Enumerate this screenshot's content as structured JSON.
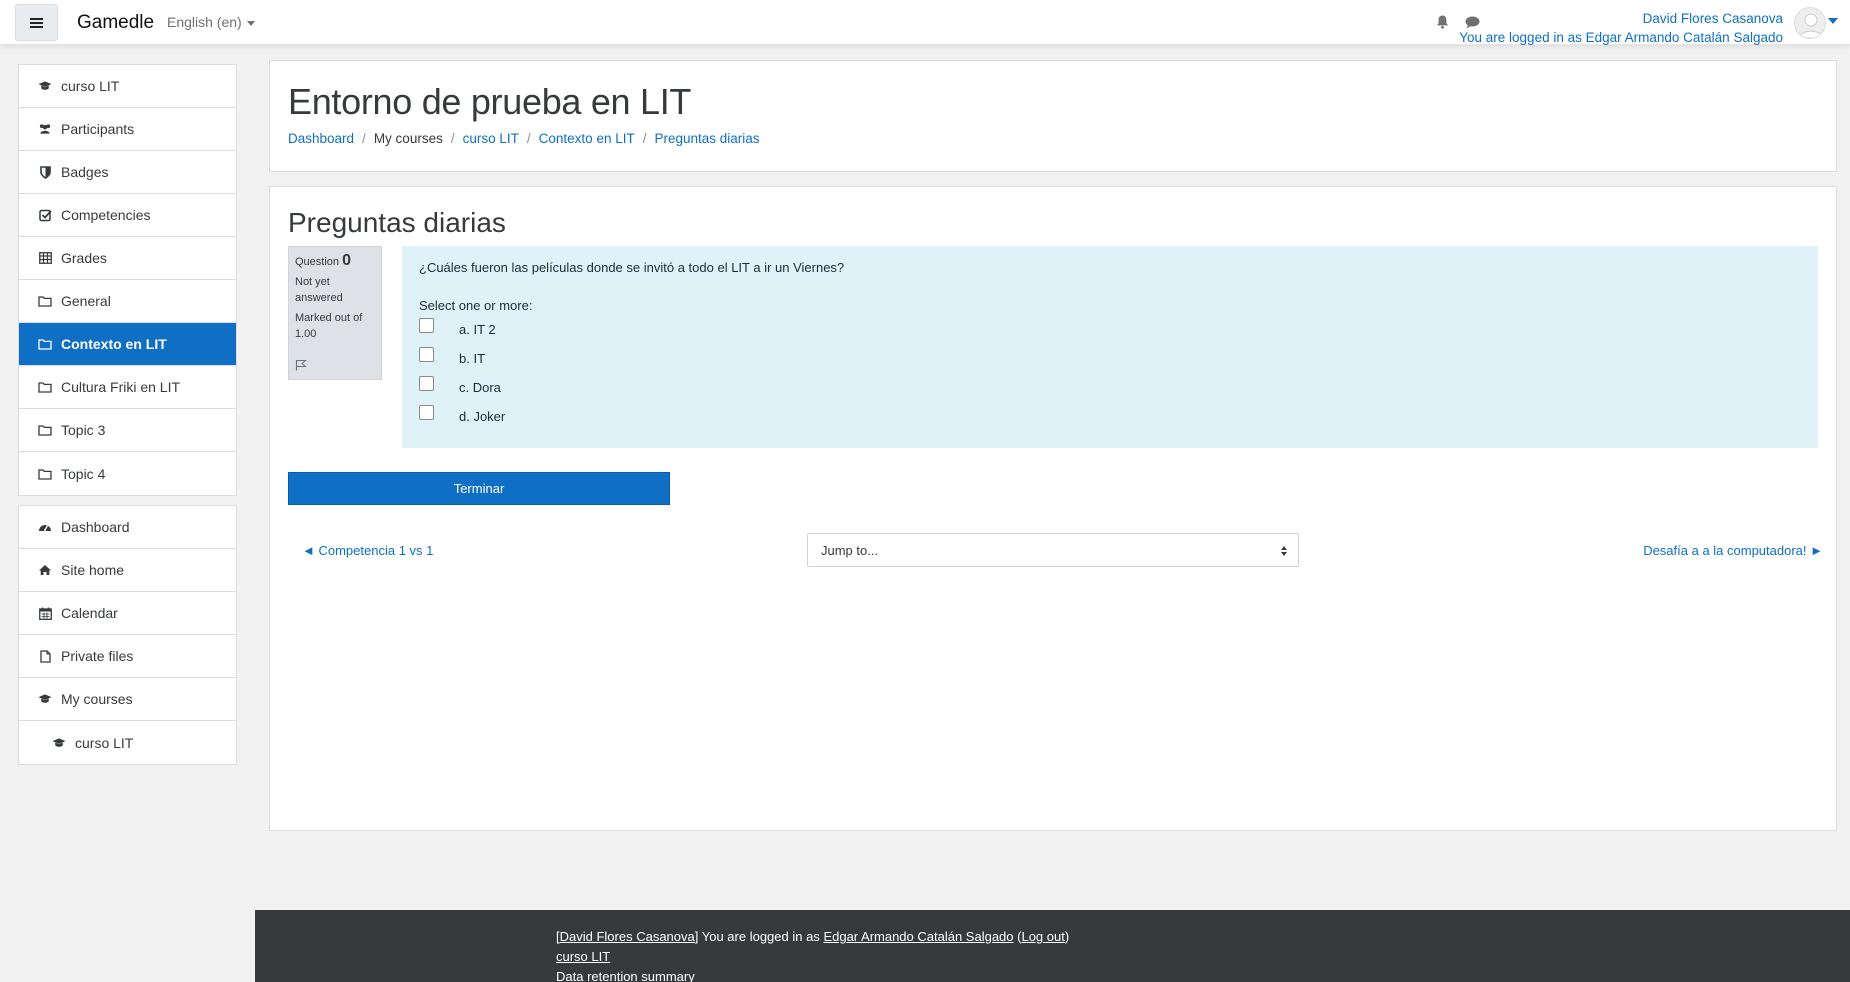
{
  "navbar": {
    "brand": "Gamedle",
    "language": "English (en)",
    "user_name": "David Flores Casanova",
    "logged_in_as": "You are logged in as Edgar Armando Catalán Salgado"
  },
  "sidebar": {
    "course_items": [
      {
        "label": "curso LIT",
        "icon": "graduation-cap-icon"
      },
      {
        "label": "Participants",
        "icon": "users-icon"
      },
      {
        "label": "Badges",
        "icon": "shield-icon"
      },
      {
        "label": "Competencies",
        "icon": "checkbox-icon"
      },
      {
        "label": "Grades",
        "icon": "table-icon"
      },
      {
        "label": "General",
        "icon": "folder-icon"
      },
      {
        "label": "Contexto en LIT",
        "icon": "folder-icon",
        "active": true
      },
      {
        "label": "Cultura Friki en LIT",
        "icon": "folder-icon"
      },
      {
        "label": "Topic 3",
        "icon": "folder-icon"
      },
      {
        "label": "Topic 4",
        "icon": "folder-icon"
      }
    ],
    "site_items": [
      {
        "label": "Dashboard",
        "icon": "dashboard-icon"
      },
      {
        "label": "Site home",
        "icon": "home-icon"
      },
      {
        "label": "Calendar",
        "icon": "calendar-icon"
      },
      {
        "label": "Private files",
        "icon": "file-icon"
      },
      {
        "label": "My courses",
        "icon": "graduation-cap-icon"
      },
      {
        "label": "curso LIT",
        "icon": "graduation-cap-icon"
      }
    ]
  },
  "header": {
    "title": "Entorno de prueba en LIT",
    "breadcrumb": [
      "Dashboard",
      "My courses",
      "curso LIT",
      "Contexto en LIT",
      "Preguntas diarias"
    ]
  },
  "quiz": {
    "title": "Preguntas diarias",
    "question_label": "Question",
    "question_number": "0",
    "status": "Not yet answered",
    "marked_out": "Marked out of 1.00",
    "question_text": "¿Cuáles fueron las películas donde se invitó a todo el LIT a ir un Viernes?",
    "prompt": "Select one or more:",
    "options": [
      "a. IT 2",
      "b. IT",
      "c. Dora",
      "d. Joker"
    ],
    "finish_button": "Terminar",
    "prev_link": "◄ Competencia 1 vs 1",
    "jump_placeholder": "Jump to...",
    "next_link": "Desafía a a la computadora! ►"
  },
  "footer": {
    "user_link": "David Flores Casanova",
    "logged_text": " You are logged in as ",
    "logged_user": "Edgar Armando Catalán Salgado",
    "logout": "Log out",
    "course_link": "curso LIT",
    "data_retention": "Data retention summary"
  },
  "colors": {
    "primary": "#0f6fc5",
    "question_bg": "#def2f8",
    "footer_bg": "#373a3c"
  }
}
